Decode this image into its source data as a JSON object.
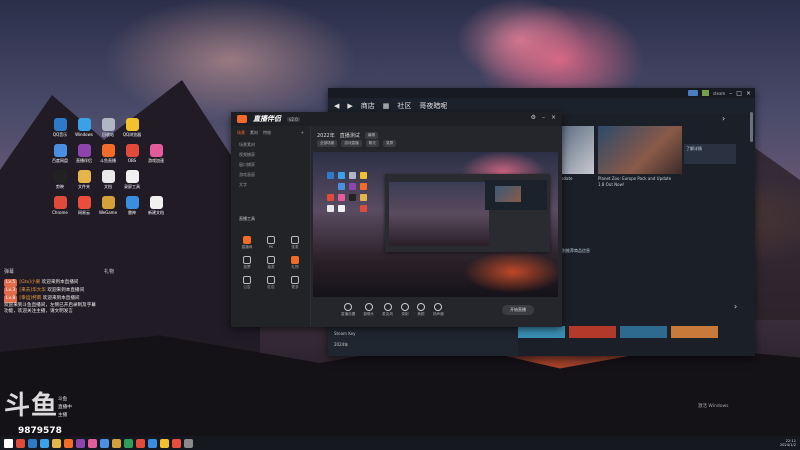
{
  "desktop": {
    "icons": [
      {
        "label": "QQ音乐",
        "color": "#2d7ac9"
      },
      {
        "label": "Windows",
        "color": "#3aa0e8"
      },
      {
        "label": "回收站",
        "color": "#b0b6c4"
      },
      {
        "label": "QQ浏览器",
        "color": "#f2c12e"
      },
      {
        "label": "",
        "color": "transparent"
      },
      {
        "label": "百度网盘",
        "color": "#4a90e2"
      },
      {
        "label": "直播伴侣",
        "color": "#8e44ad"
      },
      {
        "label": "斗鱼直播",
        "color": "#f36b28"
      },
      {
        "label": "OBS",
        "color": "#e24a3a"
      },
      {
        "label": "游戏加速",
        "color": "#e35b9b"
      },
      {
        "label": "剪映",
        "color": "#222"
      },
      {
        "label": "文件夹",
        "color": "#e6b54a"
      },
      {
        "label": "文档",
        "color": "#e9e9e9"
      },
      {
        "label": "录屏工具",
        "color": "#f1f1f1"
      },
      {
        "label": "",
        "color": "transparent"
      },
      {
        "label": "Chrome",
        "color": "#e04a3a"
      },
      {
        "label": "网易云",
        "color": "#ea4d3c"
      },
      {
        "label": "WeGame",
        "color": "#d4a03a"
      },
      {
        "label": "雷神",
        "color": "#3a8ee0"
      },
      {
        "label": "新建文档",
        "color": "#f0f0f0"
      }
    ]
  },
  "chat": {
    "header_left": "弹幕",
    "header_right": "礼物",
    "lines": [
      {
        "badge": "Lv.5",
        "nick": "[Gtx]小果",
        "text": "欢迎来到本直播间"
      },
      {
        "badge": "Lv.3",
        "nick": "[来去]华大华",
        "text": "欢迎来到本直播间"
      },
      {
        "badge": "Lv.8",
        "nick": "[幸运]柯南",
        "text": "欢迎来到本直播间"
      }
    ],
    "notice": "欢迎来到斗鱼直播间，左侧已开启录制及字幕功能，欢迎关注主播，请文明发言",
    "side_lines": [
      "斗鱼",
      "直播中",
      "主播"
    ]
  },
  "stream": {
    "logo": "斗鱼",
    "room_number": "9879578"
  },
  "back_window": {
    "account": "steam",
    "nav": [
      "商店",
      "社区",
      "哥夜暗呢"
    ],
    "banner_title": "Planet Zoo: Europe Pack and Update",
    "banner_sub": "1.8 Out Now!",
    "banner_small": "Update",
    "right_text": "了解详情",
    "mid_text": "特别推荐商品信息",
    "bottom_row1": "Steam Key",
    "bottom_row2": "2024年",
    "thumb_colors": [
      "#3a8fb5",
      "#b33a2a",
      "#2e6a8f",
      "#c87a3a"
    ]
  },
  "front_window": {
    "app_name": "直播伴侣",
    "version": "v2.0",
    "tabs": [
      "场景",
      "素材",
      "特效"
    ],
    "sources": [
      "场景素材",
      "视频捕获",
      "窗口捕获",
      "游戏画面",
      "文字"
    ],
    "section_title": "直播工具",
    "tools": [
      {
        "label": "直播间",
        "hot": true
      },
      {
        "label": "PK",
        "hot": false
      },
      {
        "label": "连麦",
        "hot": false
      },
      {
        "label": "投票",
        "hot": false
      },
      {
        "label": "抽奖",
        "hot": false
      },
      {
        "label": "礼物",
        "hot": true
      },
      {
        "label": "公告",
        "hot": false
      },
      {
        "label": "红包",
        "hot": false
      },
      {
        "label": "更多",
        "hot": false
      }
    ],
    "scene_title": "2022年",
    "scene_sub": "直播测试",
    "scene_pill": "编辑",
    "pills": [
      "全部场景",
      "游戏直播",
      "聊天",
      "录屏"
    ],
    "toolbar": [
      {
        "label": "直播设置"
      },
      {
        "label": "摄像头"
      },
      {
        "label": "麦克风"
      },
      {
        "label": "录制"
      },
      {
        "label": "美颜"
      },
      {
        "label": "扬声器"
      }
    ],
    "go_live": "开始直播"
  },
  "watermark": {
    "line1": "激活 Windows"
  },
  "taskbar": {
    "icons": [
      "#ffffff",
      "#e04a3a",
      "#2d7ac9",
      "#3aa0e8",
      "#e6b54a",
      "#f36b28",
      "#8e44ad",
      "#e35b9b",
      "#4a90e2",
      "#d4a03a",
      "#2e9e5a",
      "#e24a3a",
      "#3a8ee0",
      "#f2c12e",
      "#ea4d3c",
      "#8a8a8a"
    ],
    "time": "22:11",
    "date": "2024/1/2"
  }
}
